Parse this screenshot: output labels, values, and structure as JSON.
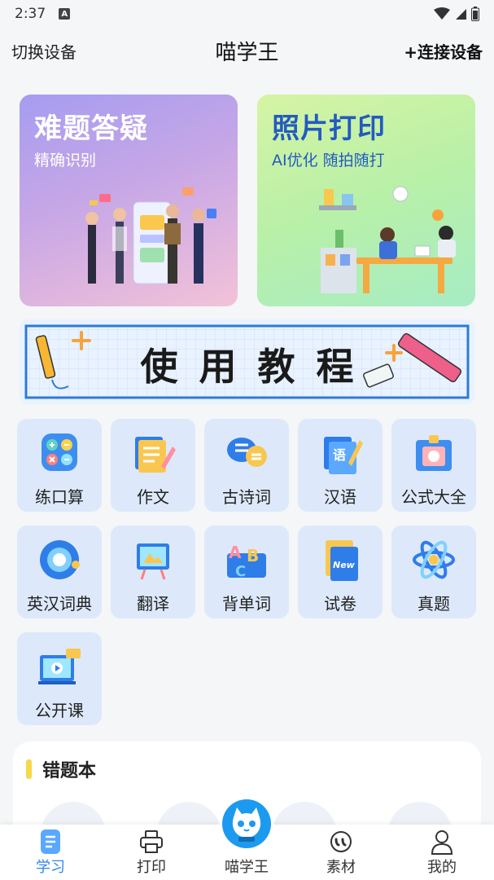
{
  "status_bar": {
    "time": "2:37",
    "badge": "A"
  },
  "header": {
    "left_action": "切换设备",
    "title": "喵学王",
    "right_action": "+连接设备"
  },
  "feature_cards": [
    {
      "title": "难题答疑",
      "subtitle": "精确识别"
    },
    {
      "title": "照片打印",
      "subtitle": "AI优化 随拍随打"
    }
  ],
  "tutorial_banner": {
    "text": "使用教程"
  },
  "tools": [
    {
      "label": "练口算",
      "icon": "calculator-icon"
    },
    {
      "label": "作文",
      "icon": "composition-icon"
    },
    {
      "label": "古诗词",
      "icon": "poetry-icon"
    },
    {
      "label": "汉语",
      "icon": "chinese-icon"
    },
    {
      "label": "公式大全",
      "icon": "formula-icon"
    },
    {
      "label": "英汉词典",
      "icon": "dictionary-icon"
    },
    {
      "label": "翻译",
      "icon": "translate-icon"
    },
    {
      "label": "背单词",
      "icon": "vocabulary-icon"
    },
    {
      "label": "试卷",
      "icon": "exam-paper-icon"
    },
    {
      "label": "真题",
      "icon": "past-exam-icon"
    },
    {
      "label": "公开课",
      "icon": "open-class-icon"
    }
  ],
  "mistake_book": {
    "title": "错题本"
  },
  "bottom_nav": [
    {
      "label": "学习",
      "icon": "study-icon",
      "active": true
    },
    {
      "label": "打印",
      "icon": "printer-icon",
      "active": false
    },
    {
      "label": "喵学王",
      "icon": "cat-logo-icon",
      "active": false
    },
    {
      "label": "素材",
      "icon": "material-icon",
      "active": false
    },
    {
      "label": "我的",
      "icon": "profile-icon",
      "active": false
    }
  ],
  "colors": {
    "accent": "#2f86f0",
    "tile_bg": "#dde9fb",
    "print_title": "#235bc0",
    "brand_blue": "#1c9af0"
  }
}
